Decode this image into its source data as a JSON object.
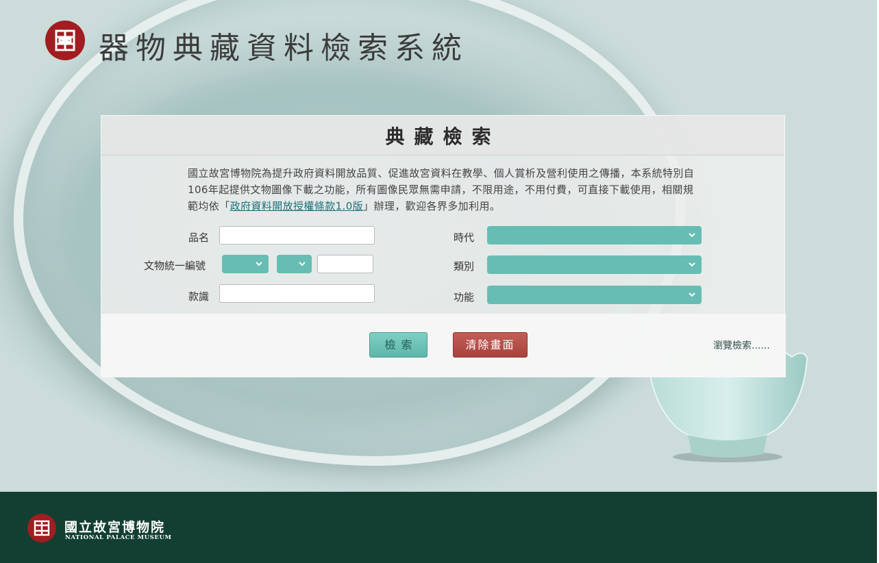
{
  "header": {
    "title": "器物典藏資料檢索系統"
  },
  "panel": {
    "title": "典藏檢索",
    "intro_before_link": "國立故宮博物院為提升政府資料開放品質、促進故宮資料在教學、個人賞析及營利使用之傳播，本系統特別自106年起提供文物圖像下載之功能，所有圖像民眾無需申請，不限用途，不用付費，可直接下載使用，相關規範均依「",
    "intro_link": "政府資料開放授權條款1.0版",
    "intro_after_link": "」辦理，歡迎各界多加利用。"
  },
  "form": {
    "name_label": "品名",
    "name_value": "",
    "catalog_label": "文物統一編號",
    "catalog_value": "",
    "inscription_label": "款識",
    "inscription_value": "",
    "period_label": "時代",
    "period_value": "",
    "category_label": "類別",
    "category_value": "",
    "function_label": "功能",
    "function_value": ""
  },
  "actions": {
    "search_label": "檢索",
    "clear_label": "清除畫面",
    "browse_label": "瀏覽檢索......"
  },
  "footer": {
    "name_zh": "國立故宮博物院",
    "name_en": "NATIONAL PALACE MUSEUM"
  },
  "colors": {
    "select_bg": "#67bdb3",
    "search_button": "#67bdb3",
    "clear_button": "#b24c46",
    "footer_bg": "#123f31",
    "logo_red": "#a01d20"
  },
  "icons": {
    "select_arrow": "chevron-down-icon",
    "logo": "npm-logo-icon"
  }
}
